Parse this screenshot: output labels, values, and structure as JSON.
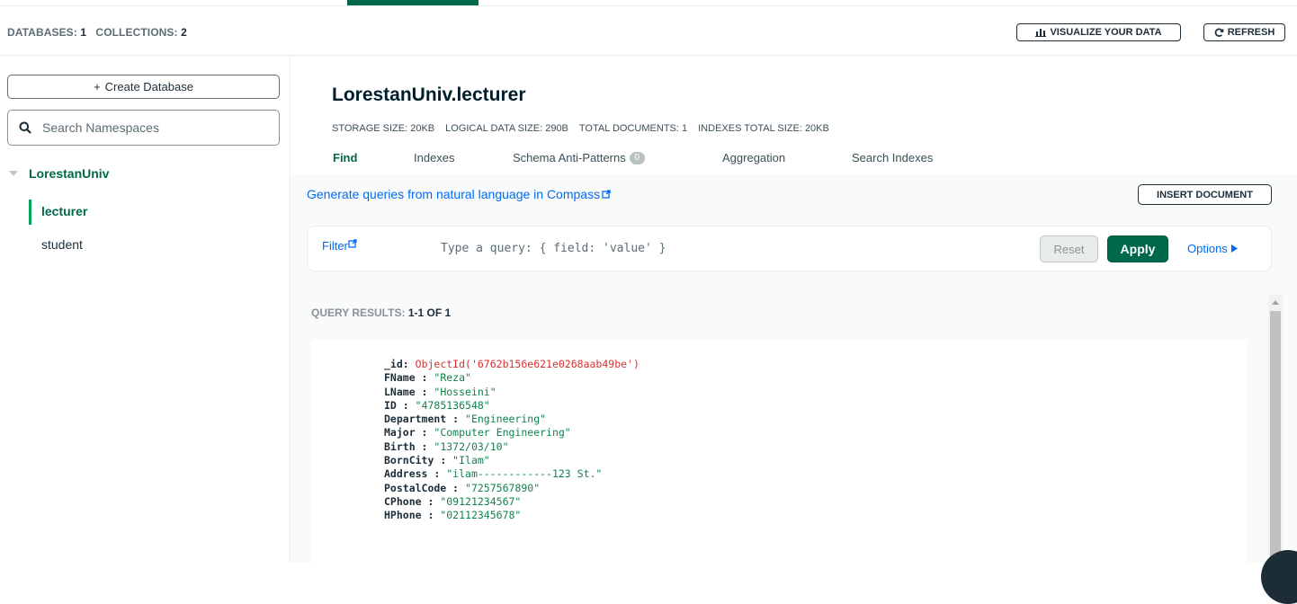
{
  "header": {
    "databases_label": "DATABASES:",
    "databases_count": "1",
    "collections_label": "COLLECTIONS:",
    "collections_count": "2",
    "visualize_label": "VISUALIZE YOUR DATA",
    "refresh_label": "REFRESH"
  },
  "sidebar": {
    "create_database_label": "Create Database",
    "search_placeholder": "Search Namespaces",
    "database": "LorestanUniv",
    "collections": [
      {
        "name": "lecturer",
        "active": true
      },
      {
        "name": "student",
        "active": false
      }
    ]
  },
  "main": {
    "namespace": "LorestanUniv.lecturer",
    "stats": [
      {
        "label": "STORAGE SIZE:",
        "value": "20KB"
      },
      {
        "label": "LOGICAL DATA SIZE:",
        "value": "290B"
      },
      {
        "label": "TOTAL DOCUMENTS:",
        "value": "1"
      },
      {
        "label": "INDEXES TOTAL SIZE:",
        "value": "20KB"
      }
    ],
    "tabs": [
      {
        "label": "Find",
        "active": true
      },
      {
        "label": "Indexes"
      },
      {
        "label": "Schema Anti-Patterns",
        "badge": "0"
      },
      {
        "label": "Aggregation"
      },
      {
        "label": "Search Indexes"
      }
    ],
    "generate_link": "Generate queries from natural language in Compass",
    "insert_document_label": "INSERT DOCUMENT",
    "filter": {
      "label": "Filter",
      "placeholder": "Type a query: { field: 'value' }",
      "value": "",
      "reset_label": "Reset",
      "apply_label": "Apply",
      "options_label": "Options"
    },
    "results": {
      "label": "QUERY RESULTS:",
      "count": "1-1 OF 1"
    },
    "document": {
      "id_key": "_id",
      "id_value": "ObjectId('6762b156e621e0268aab49be')",
      "fields": [
        {
          "key": "FName",
          "value": "\"Reza\""
        },
        {
          "key": "LName",
          "value": "\"Hosseini\""
        },
        {
          "key": "ID",
          "value": "\"4785136548\""
        },
        {
          "key": "Department",
          "value": "\"Engineering\""
        },
        {
          "key": "Major",
          "value": "\"Computer Engineering\""
        },
        {
          "key": "Birth",
          "value": "\"1372/03/10\""
        },
        {
          "key": "BornCity",
          "value": "\"Ilam\""
        },
        {
          "key": "Address",
          "value": "\"ilam------------123 St.\""
        },
        {
          "key": "PostalCode",
          "value": "\"7257567890\""
        },
        {
          "key": "CPhone",
          "value": "\"09121234567\""
        },
        {
          "key": "HPhone",
          "value": "\"02112345678\""
        }
      ]
    }
  },
  "colors": {
    "accent_green": "#00684a",
    "link_blue": "#016bf8",
    "objectid_red": "#db3030",
    "string_green": "#12824d"
  },
  "icons": [
    "chart-icon",
    "refresh-icon",
    "plus-icon",
    "search-icon",
    "caret-down-icon",
    "external-link-icon",
    "play-triangle-icon"
  ]
}
